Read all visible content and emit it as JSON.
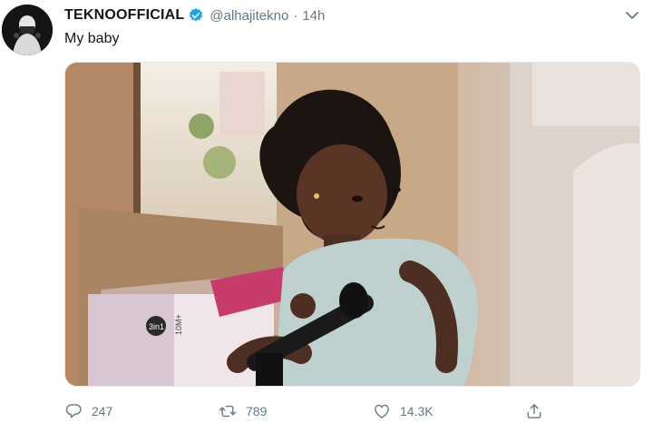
{
  "tweet": {
    "display_name": "TEKNOOFFICIAL",
    "handle": "@alhajitekno",
    "separator": "·",
    "time": "14h",
    "text": "My baby",
    "media": {
      "box_text_1": "3in1",
      "box_text_2": "10M+"
    },
    "actions": {
      "reply_count": "247",
      "retweet_count": "789",
      "like_count": "14.3K"
    },
    "colors": {
      "verified": "#1da1f2",
      "secondary_text": "#657786",
      "primary_text": "#14171a"
    },
    "icons": [
      "verified-badge-icon",
      "chevron-down-icon",
      "reply-icon",
      "retweet-icon",
      "like-icon",
      "share-icon"
    ]
  }
}
